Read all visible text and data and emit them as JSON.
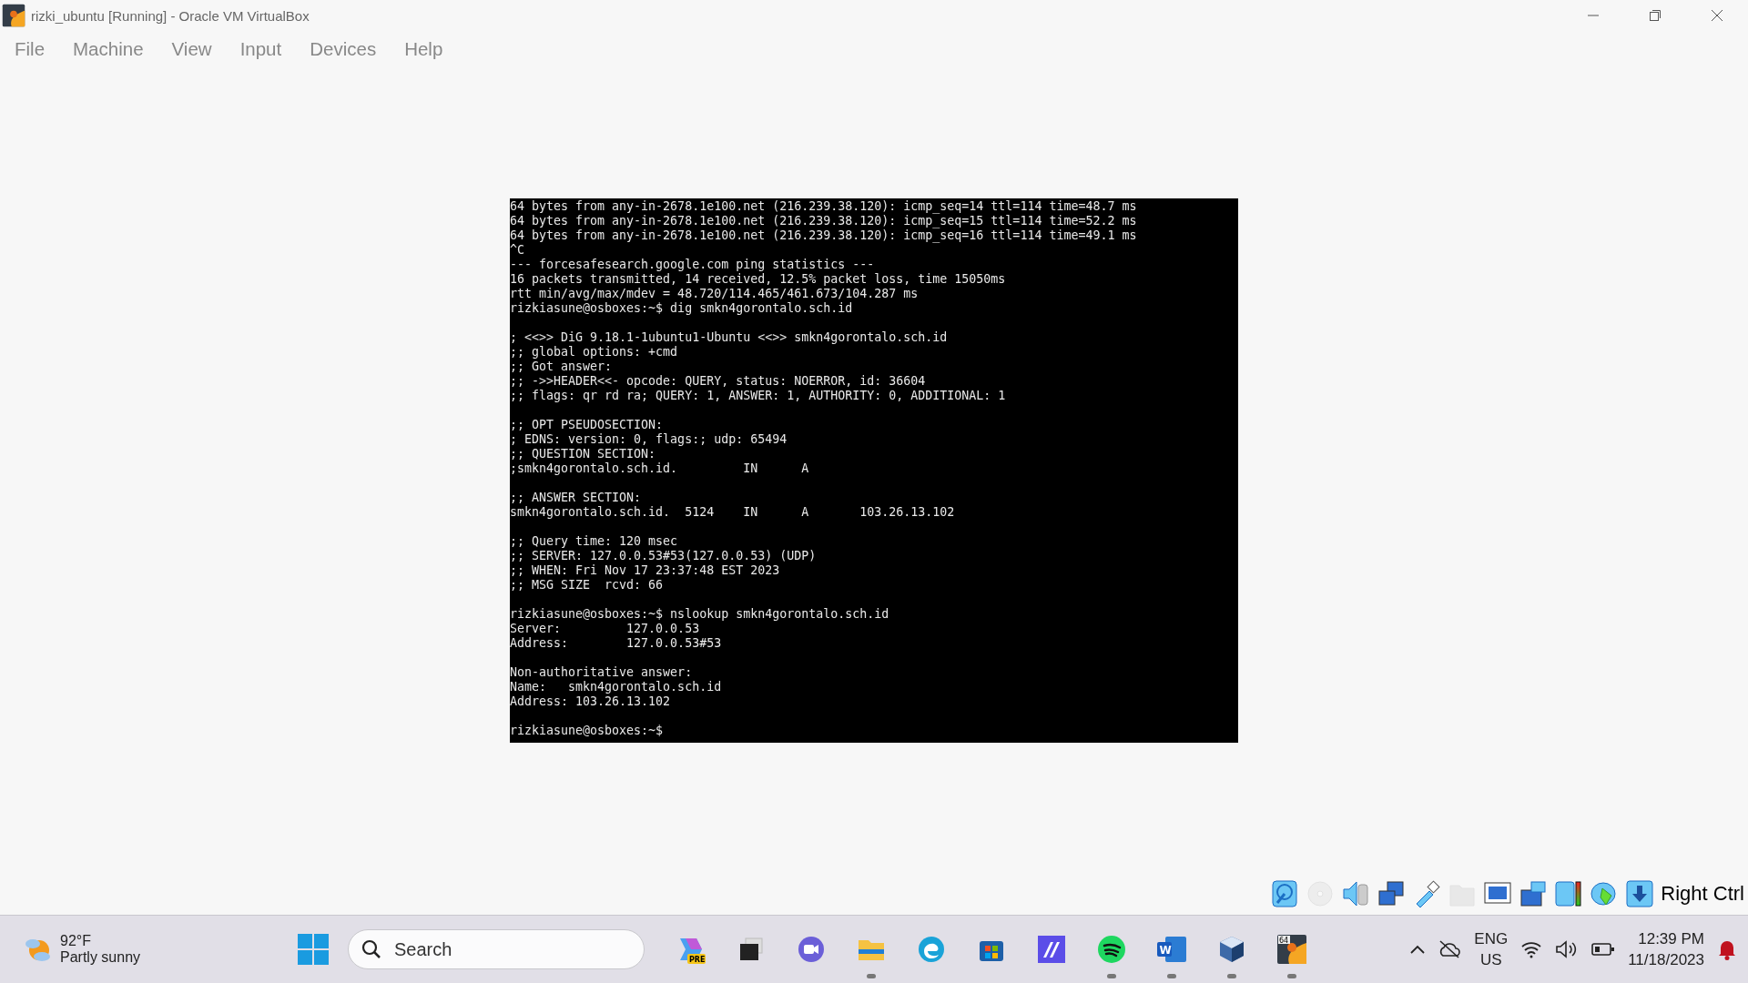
{
  "window": {
    "title": "rizki_ubuntu [Running] - Oracle VM VirtualBox"
  },
  "menu": [
    "File",
    "Machine",
    "View",
    "Input",
    "Devices",
    "Help"
  ],
  "terminal": {
    "blocks": [
      [
        "64 bytes from any-in-2678.1e100.net (216.239.38.120): icmp_seq=14 ttl=114 time=48.7 ms",
        "64 bytes from any-in-2678.1e100.net (216.239.38.120): icmp_seq=15 ttl=114 time=52.2 ms",
        "64 bytes from any-in-2678.1e100.net (216.239.38.120): icmp_seq=16 ttl=114 time=49.1 ms",
        "^C",
        "--- forcesafesearch.google.com ping statistics ---",
        "16 packets transmitted, 14 received, 12.5% packet loss, time 15050ms",
        "rtt min/avg/max/mdev = 48.720/114.465/461.673/104.287 ms",
        "rizkiasune@osboxes:~$ dig smkn4gorontalo.sch.id"
      ],
      [
        "; <<>> DiG 9.18.1-1ubuntu1-Ubuntu <<>> smkn4gorontalo.sch.id",
        ";; global options: +cmd",
        ";; Got answer:",
        ";; ->>HEADER<<- opcode: QUERY, status: NOERROR, id: 36604",
        ";; flags: qr rd ra; QUERY: 1, ANSWER: 1, AUTHORITY: 0, ADDITIONAL: 1"
      ],
      [
        ";; OPT PSEUDOSECTION:",
        "; EDNS: version: 0, flags:; udp: 65494",
        ";; QUESTION SECTION:",
        ";smkn4gorontalo.sch.id.         IN      A"
      ],
      [
        ";; ANSWER SECTION:",
        "smkn4gorontalo.sch.id.  5124    IN      A       103.26.13.102"
      ],
      [
        ";; Query time: 120 msec",
        ";; SERVER: 127.0.0.53#53(127.0.0.53) (UDP)",
        ";; WHEN: Fri Nov 17 23:37:48 EST 2023",
        ";; MSG SIZE  rcvd: 66"
      ],
      [
        "rizkiasune@osboxes:~$ nslookup smkn4gorontalo.sch.id",
        "Server:         127.0.0.53",
        "Address:        127.0.0.53#53"
      ],
      [
        "Non-authoritative answer:",
        "Name:   smkn4gorontalo.sch.id",
        "Address: 103.26.13.102"
      ],
      [
        "rizkiasune@osboxes:~$"
      ]
    ]
  },
  "vm_status": {
    "icons": [
      {
        "kind": "disk",
        "disabled": false
      },
      {
        "kind": "optical",
        "disabled": true
      },
      {
        "kind": "audio",
        "disabled": false
      },
      {
        "kind": "network",
        "disabled": false
      },
      {
        "kind": "usb",
        "disabled": false
      },
      {
        "kind": "folder",
        "disabled": true
      },
      {
        "kind": "display",
        "disabled": false
      },
      {
        "kind": "capture",
        "disabled": false
      },
      {
        "kind": "cpu",
        "disabled": false
      },
      {
        "kind": "mouse",
        "disabled": false
      },
      {
        "kind": "keyboard",
        "disabled": false
      }
    ],
    "host_key": "Right Ctrl"
  },
  "taskbar": {
    "weather": {
      "temperature": "92°F",
      "condition": "Partly sunny"
    },
    "search": {
      "placeholder": "Search"
    },
    "apps": [
      {
        "kind": "copilot",
        "badge": "PRE",
        "running": false
      },
      {
        "kind": "taskview",
        "running": false
      },
      {
        "kind": "chat",
        "running": false
      },
      {
        "kind": "files",
        "running": true
      },
      {
        "kind": "browser",
        "running": false
      },
      {
        "kind": "store",
        "running": false
      },
      {
        "kind": "ai",
        "running": false
      },
      {
        "kind": "music",
        "running": true
      },
      {
        "kind": "word",
        "label": "W",
        "running": true
      },
      {
        "kind": "cube",
        "running": true
      },
      {
        "kind": "vbox",
        "label": "64",
        "running": true
      }
    ],
    "tray": {
      "language": "ENG",
      "region": "US",
      "time": "12:39 PM",
      "date": "11/18/2023"
    }
  }
}
